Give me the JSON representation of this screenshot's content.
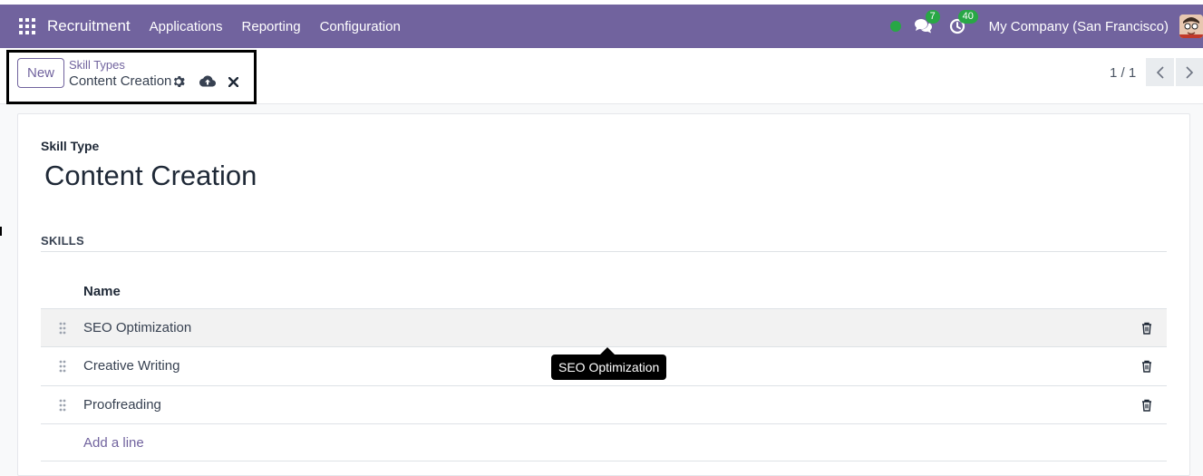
{
  "navbar": {
    "app_name": "Recruitment",
    "menus": [
      "Applications",
      "Reporting",
      "Configuration"
    ],
    "messages_count": "7",
    "activities_count": "40",
    "company": "My Company (San Francisco)",
    "presence_color": "#28a745"
  },
  "control_panel": {
    "new_label": "New",
    "breadcrumb_parent": "Skill Types",
    "breadcrumb_current": "Content Creation",
    "pager": "1 / 1"
  },
  "form": {
    "field_label": "Skill Type",
    "title": "Content Creation",
    "section_title": "SKILLS",
    "column_header": "Name",
    "rows": [
      {
        "name": "SEO Optimization"
      },
      {
        "name": "Creative Writing"
      },
      {
        "name": "Proofreading"
      }
    ],
    "add_line": "Add a line",
    "tooltip": "SEO Optimization"
  },
  "colors": {
    "brand": "#71639e",
    "badge": "#28a745"
  }
}
